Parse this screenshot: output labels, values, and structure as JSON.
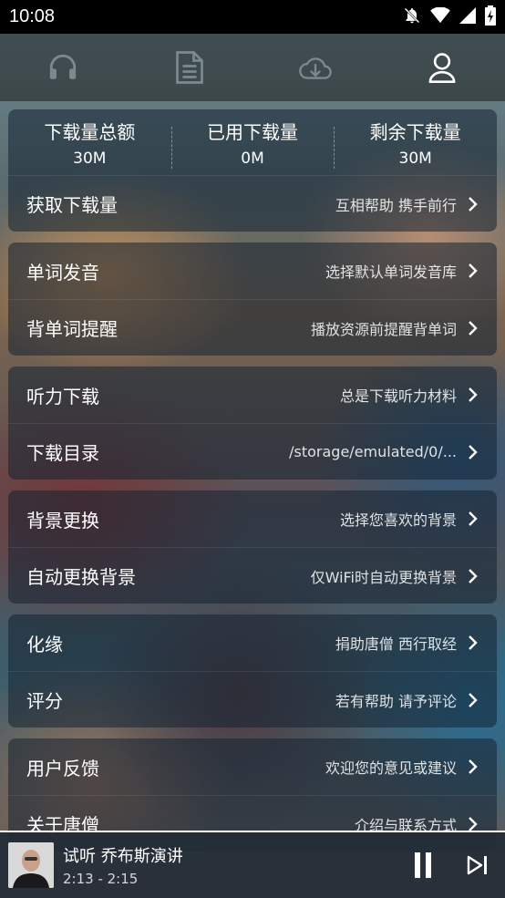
{
  "status_bar": {
    "time": "10:08"
  },
  "tabs": [
    {
      "icon": "headphones-icon"
    },
    {
      "icon": "document-icon"
    },
    {
      "icon": "cloud-download-icon"
    },
    {
      "icon": "user-icon",
      "active": true
    }
  ],
  "download_stats": {
    "total_label": "下载量总额",
    "total_value": "30M",
    "used_label": "已用下载量",
    "used_value": "0M",
    "remaining_label": "剩余下载量",
    "remaining_value": "30M"
  },
  "get_download": {
    "title": "获取下载量",
    "value": "互相帮助 携手前行"
  },
  "word_pronunciation": {
    "title": "单词发音",
    "value": "选择默认单词发音库"
  },
  "vocab_reminder": {
    "title": "背单词提醒",
    "value": "播放资源前提醒背单词"
  },
  "listening_download": {
    "title": "听力下载",
    "value": "总是下载听力材料"
  },
  "download_dir": {
    "title": "下载目录",
    "value": "/storage/emulated/0/..."
  },
  "background_change": {
    "title": "背景更换",
    "value": "选择您喜欢的背景"
  },
  "auto_background": {
    "title": "自动更换背景",
    "value": "仅WiFi时自动更换背景"
  },
  "donate": {
    "title": "化缘",
    "value": "捐助唐僧 西行取经"
  },
  "rating": {
    "title": "评分",
    "value": "若有帮助 请予评论"
  },
  "feedback": {
    "title": "用户反馈",
    "value": "欢迎您的意见或建议"
  },
  "about": {
    "title": "关于唐僧",
    "value": "介绍与联系方式"
  },
  "player": {
    "track_name": "试听 乔布斯演讲",
    "time": "2:13 - 2:15",
    "state": "playing"
  },
  "colors": {
    "accent": "#ffffff",
    "card_bg": "#14233280"
  }
}
